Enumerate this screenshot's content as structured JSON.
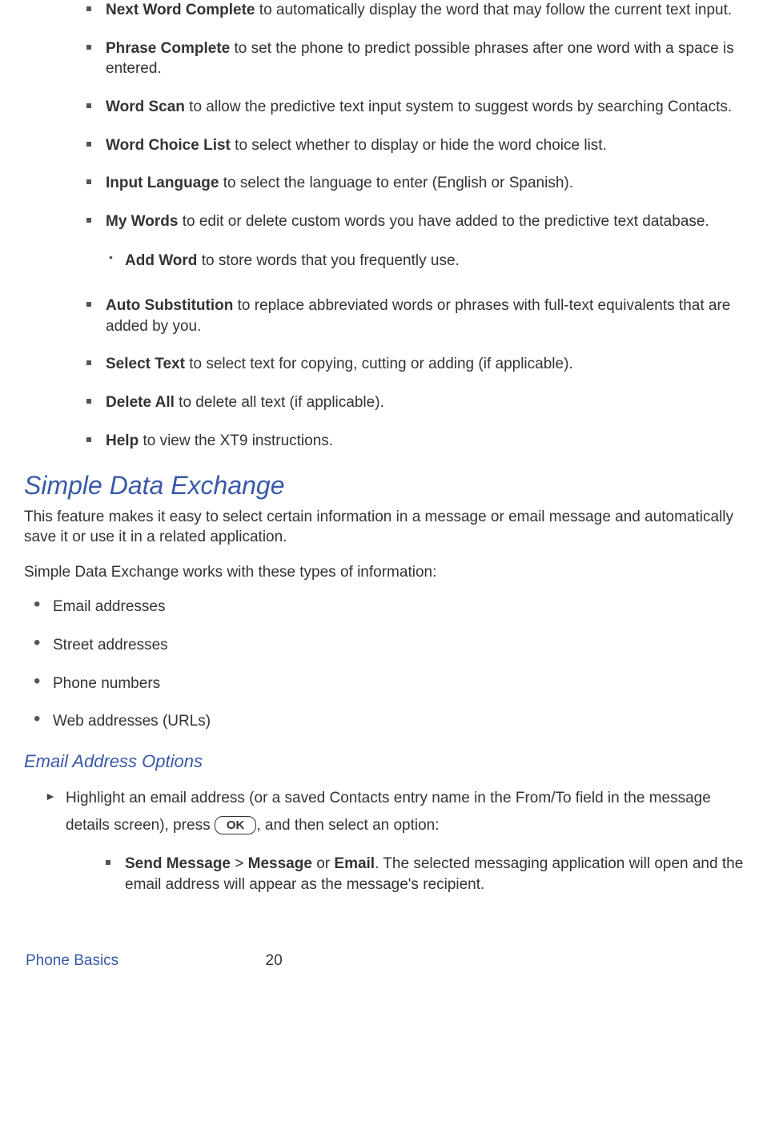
{
  "list1": [
    {
      "term": "Next Word Complete",
      "desc": " to automatically display the word that may follow the current text input."
    },
    {
      "term": "Phrase Complete",
      "desc": " to set the phone to predict possible phrases after one word with a space is entered."
    },
    {
      "term": "Word Scan",
      "desc": " to allow the predictive text input system to suggest words by searching Contacts."
    },
    {
      "term": "Word Choice List",
      "desc": " to select whether to display or hide the word choice list."
    },
    {
      "term": "Input Language",
      "desc": " to select the language to enter (English or Spanish)."
    },
    {
      "term": "My Words",
      "desc": " to edit or delete custom words you have added to the predictive text database.",
      "sub": {
        "term": "Add Word",
        "desc": " to store words that you frequently use."
      }
    },
    {
      "term": "Auto Substitution",
      "desc": " to replace abbreviated words or phrases with full-text equivalents that are added by you."
    },
    {
      "term": "Select Text",
      "desc": " to select text for copying, cutting or adding (if applicable)."
    },
    {
      "term": "Delete All",
      "desc": " to delete all text (if applicable)."
    },
    {
      "term": "Help",
      "desc": " to view the XT9 instructions."
    }
  ],
  "heading": "Simple Data Exchange",
  "para1": "This feature makes it easy to select certain information in a message or email message and automatically save it or use it in a related application.",
  "para2": "Simple Data Exchange works with these types of information:",
  "info_types": [
    "Email addresses",
    "Street addresses",
    "Phone numbers",
    "Web addresses (URLs)"
  ],
  "subheading": "Email Address Options",
  "arrow_item": {
    "pre": "Highlight an email address (or a saved Contacts entry name in the From/To field in the message details screen), press ",
    "key": "OK",
    "post": ", and then select an option:"
  },
  "send_msg": {
    "t1": "Send Message",
    "sep": " > ",
    "t2": "Message",
    "or": " or ",
    "t3": "Email",
    "desc": ". The selected messaging application will open and the email address will appear as the message's recipient."
  },
  "footer": {
    "section": "Phone Basics",
    "page": "20"
  }
}
